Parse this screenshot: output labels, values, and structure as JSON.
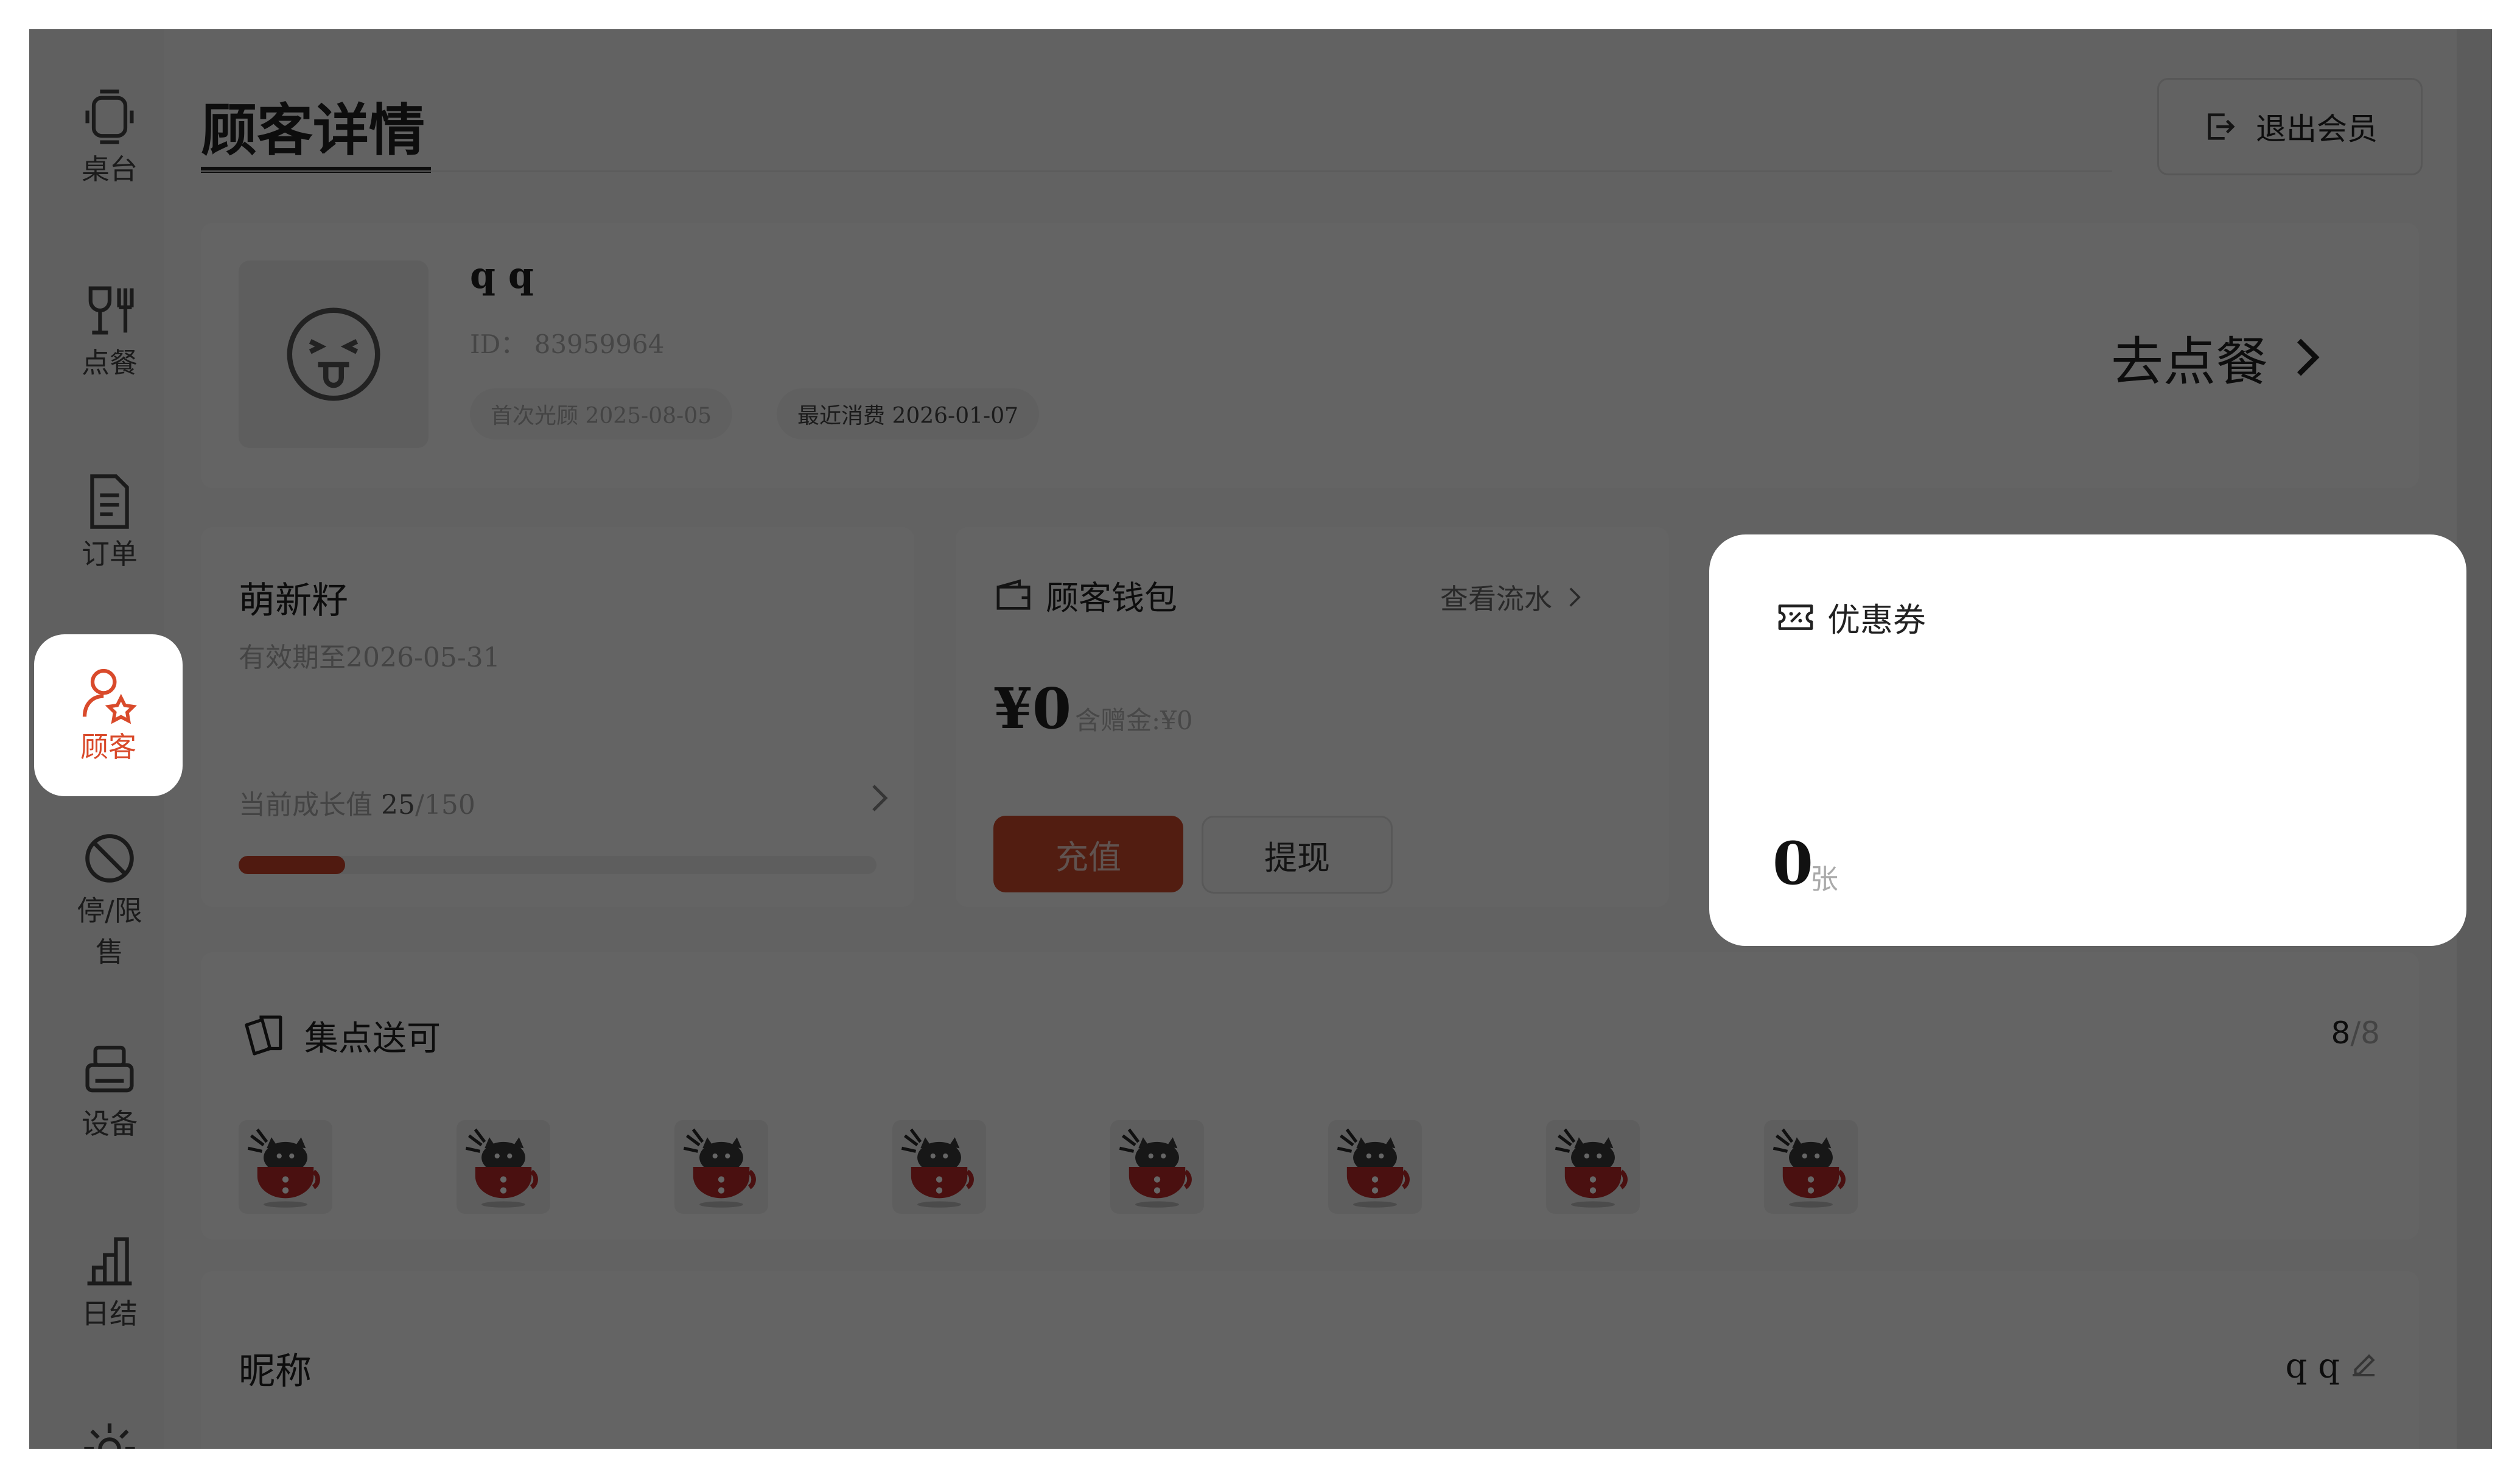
{
  "sidebar": {
    "items": [
      {
        "label": "桌台",
        "icon": "table-icon"
      },
      {
        "label": "点餐",
        "icon": "dining-icon"
      },
      {
        "label": "订单",
        "icon": "order-icon"
      },
      {
        "label": "顾客",
        "icon": "customer-icon",
        "active": true
      },
      {
        "label": "停/限售",
        "icon": "ban-icon"
      },
      {
        "label": "设备",
        "icon": "printer-icon"
      },
      {
        "label": "日结",
        "icon": "chart-icon"
      },
      {
        "label": "",
        "icon": "settings-icon"
      }
    ]
  },
  "header": {
    "title": "顾客详情",
    "exit_label": "退出会员"
  },
  "profile": {
    "name": "q q",
    "id_text": "ID：  83959964",
    "first_visit": "首次光顾 2025-08-05",
    "last_spend": "最近消费 2026-01-07",
    "goto_order": "去点餐"
  },
  "membership": {
    "level": "萌新籽",
    "expire": "有效期至2026-05-31",
    "growth_label": "当前成长值 ",
    "growth_current": "25",
    "growth_total": "/150",
    "growth_fraction": 0.1667
  },
  "wallet": {
    "title": "顾客钱包",
    "flow_link": "查看流水",
    "balance": "¥0",
    "gift": "含赠金:¥0",
    "recharge": "充值",
    "withdraw": "提现"
  },
  "coupon": {
    "title": "优惠券",
    "count": "0",
    "unit": "张"
  },
  "stamps": {
    "title": "集点送可",
    "collected": "8",
    "total": "/8",
    "items": 8
  },
  "nickname": {
    "label": "昵称",
    "value": "q q"
  },
  "colors": {
    "accent": "#d94a2b",
    "overlay": "rgba(0,0,0,0.6)"
  }
}
